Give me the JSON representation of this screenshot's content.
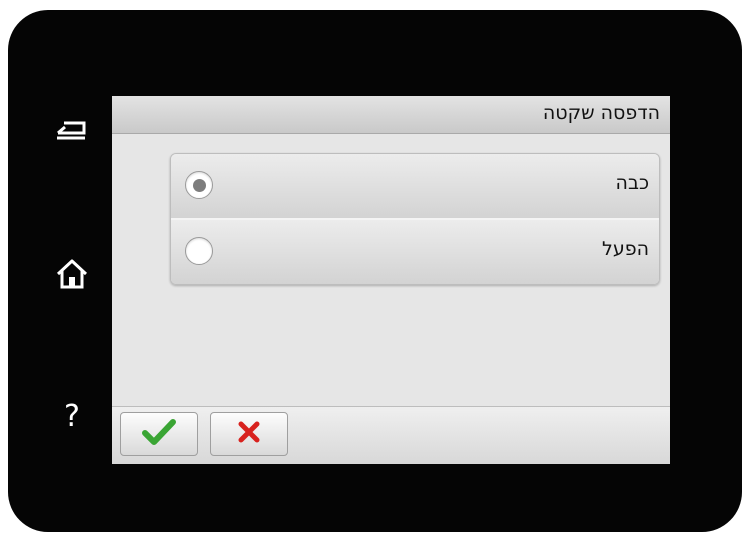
{
  "screen": {
    "title": "הדפסה שקטה"
  },
  "options": [
    {
      "label": "כבה",
      "selected": true
    },
    {
      "label": "הפעל",
      "selected": false
    }
  ],
  "side_buttons": {
    "back_icon": "back-arrow-icon",
    "home_icon": "home-icon",
    "help_label": "?"
  },
  "actions": {
    "confirm_icon": "checkmark-icon",
    "cancel_icon": "x-icon"
  },
  "colors": {
    "confirm": "#3aa534",
    "cancel": "#d8221e",
    "bezel": "#050505",
    "screen_bg": "#e6e6e6"
  }
}
